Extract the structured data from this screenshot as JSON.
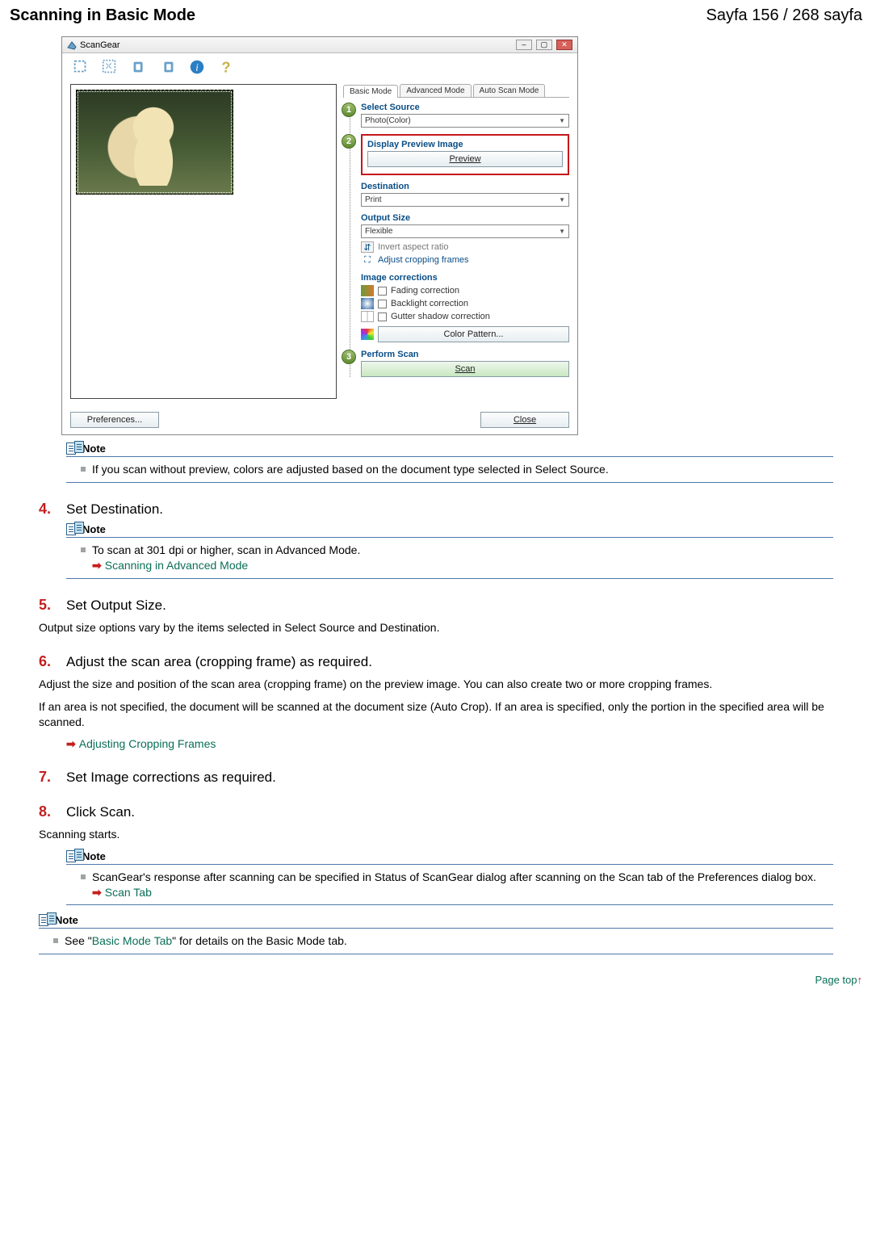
{
  "header": {
    "title": "Scanning in Basic Mode",
    "page": "Sayfa 156 / 268 sayfa"
  },
  "scangear": {
    "title": "ScanGear",
    "toolbar_icons": [
      "crop-icon",
      "auto-crop-icon",
      "rotate-left-icon",
      "rotate-right-icon",
      "info-icon",
      "help-icon"
    ],
    "tabs": {
      "basic": "Basic Mode",
      "advanced": "Advanced Mode",
      "auto": "Auto Scan Mode"
    },
    "step1_label": "Select Source",
    "source_value": "Photo(Color)",
    "step2_label": "Display Preview Image",
    "preview_btn": "Preview",
    "dest_label": "Destination",
    "dest_value": "Print",
    "outsize_label": "Output Size",
    "outsize_value": "Flexible",
    "invert_label": "Invert aspect ratio",
    "adjust_crop": "Adjust cropping frames",
    "imgcorr_label": "Image corrections",
    "fading": "Fading correction",
    "backlight": "Backlight correction",
    "gutter": "Gutter shadow correction",
    "color_pattern": "Color Pattern...",
    "step3_label": "Perform Scan",
    "scan_btn": "Scan",
    "pref_btn": "Preferences...",
    "close_btn": "Close"
  },
  "notes": {
    "n1": "If you scan without preview, colors are adjusted based on the document type selected in Select Source.",
    "n2": "To scan at 301 dpi or higher, scan in Advanced Mode.",
    "n2_link": "Scanning in Advanced Mode",
    "n3": "ScanGear's response after scanning can be specified in Status of ScanGear dialog after scanning on the Scan tab of the Preferences dialog box.",
    "n3_link": "Scan Tab",
    "n4_pre": "See \"",
    "n4_link": "Basic Mode Tab",
    "n4_post": "\" for details on the Basic Mode tab.",
    "note_label": "Note"
  },
  "steps": {
    "s4": "Set Destination.",
    "s5": "Set Output Size.",
    "s5_body": "Output size options vary by the items selected in Select Source and Destination.",
    "s6": "Adjust the scan area (cropping frame) as required.",
    "s6_b1": "Adjust the size and position of the scan area (cropping frame) on the preview image. You can also create two or more cropping frames.",
    "s6_b2": "If an area is not specified, the document will be scanned at the document size (Auto Crop). If an area is specified, only the portion in the specified area will be scanned.",
    "s6_link": "Adjusting Cropping Frames",
    "s7": "Set Image corrections as required.",
    "s8": "Click Scan.",
    "s8_body": "Scanning starts."
  },
  "pagetop": "Page top"
}
